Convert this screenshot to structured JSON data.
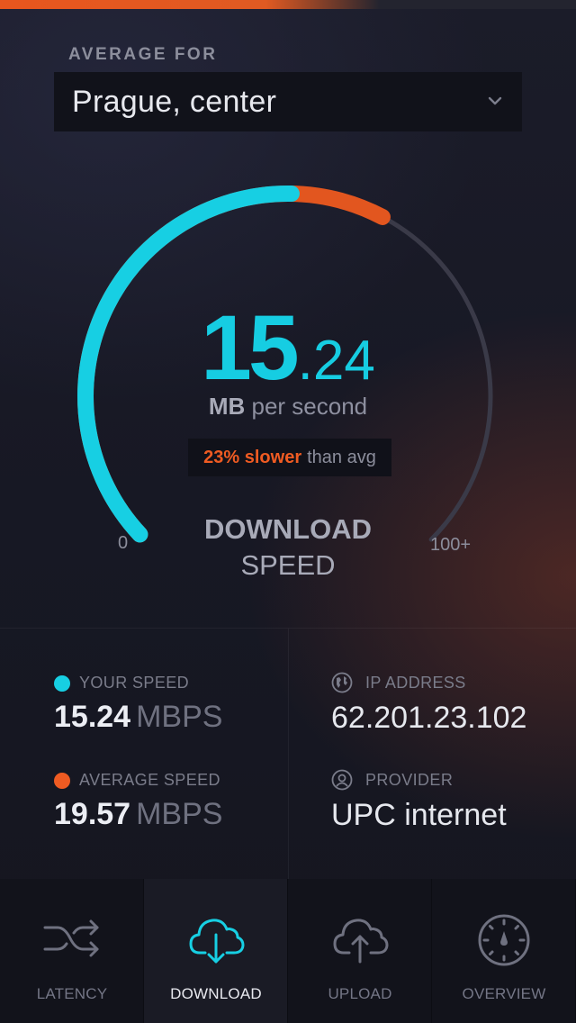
{
  "top_progress": {
    "fraction": 0.66,
    "color": "#e8561e"
  },
  "header": {
    "label": "AVERAGE FOR",
    "location": "Prague, center",
    "chevron_icon": "chevron-down-icon"
  },
  "gauge": {
    "value_int": "15",
    "value_dec": ".24",
    "unit_bold": "MB",
    "unit_rest": "per second",
    "compare_pct": "23% slower",
    "compare_rest": "than avg",
    "scale_min": "0",
    "scale_max": "100+",
    "title": "DOWNLOAD",
    "subtitle": "SPEED",
    "your_fraction": 0.5,
    "avg_fraction": 0.6,
    "colors": {
      "your": "#17cfe3",
      "avg": "#e2561f",
      "track": "#3a3a48"
    }
  },
  "stats": {
    "your_speed": {
      "label": "YOUR SPEED",
      "value": "15.24",
      "unit": "MBPS",
      "color": "#17cfe3"
    },
    "average_speed": {
      "label": "AVERAGE SPEED",
      "value": "19.57",
      "unit": "MBPS",
      "color": "#ef5b22"
    },
    "ip_address": {
      "label": "IP ADDRESS",
      "value": "62.201.23.102",
      "icon": "globe-icon"
    },
    "provider": {
      "label": "PROVIDER",
      "value": "UPC internet",
      "icon": "user-icon"
    }
  },
  "tabs": [
    {
      "label": "LATENCY",
      "icon": "shuffle-icon",
      "active": false
    },
    {
      "label": "DOWNLOAD",
      "icon": "cloud-download-icon",
      "active": true
    },
    {
      "label": "UPLOAD",
      "icon": "cloud-upload-icon",
      "active": false
    },
    {
      "label": "OVERVIEW",
      "icon": "compass-icon",
      "active": false
    }
  ]
}
